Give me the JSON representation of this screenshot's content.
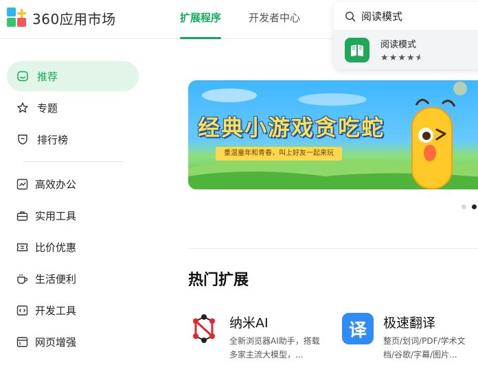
{
  "header": {
    "logo_text": "360应用市场",
    "tabs": [
      {
        "label": "扩展程序",
        "active": true
      },
      {
        "label": "开发者中心",
        "active": false
      }
    ]
  },
  "search": {
    "value": "阅读模式",
    "suggestion": {
      "name": "阅读模式",
      "rating": 4.5,
      "icon": "book-icon"
    }
  },
  "sidebar": {
    "items": [
      {
        "label": "推荐",
        "icon": "home-icon",
        "active": true
      },
      {
        "label": "专题",
        "icon": "star-icon"
      },
      {
        "label": "排行榜",
        "icon": "shield-icon"
      }
    ],
    "categories": [
      {
        "label": "高效办公",
        "icon": "chart-icon"
      },
      {
        "label": "实用工具",
        "icon": "toolbox-icon"
      },
      {
        "label": "比价优惠",
        "icon": "coupon-icon"
      },
      {
        "label": "生活便利",
        "icon": "cup-icon"
      },
      {
        "label": "开发工具",
        "icon": "code-icon"
      },
      {
        "label": "网页增强",
        "icon": "browser-icon"
      }
    ]
  },
  "banner": {
    "title": "经典小游戏贪吃蛇",
    "subtitle": "重温童年和青春，叫上好友一起来玩",
    "slide_count": 2,
    "active_slide": 2
  },
  "section": {
    "title": "热门扩展"
  },
  "cards": [
    {
      "name": "纳米AI",
      "desc": "全新浏览器AI助手，搭载多家主流大模型，...",
      "icon": "nami-ai-icon"
    },
    {
      "name": "极速翻译",
      "desc": "整页/划词/PDF/学术文档/谷歌/字幕/图片...",
      "icon": "translate-icon",
      "glyph": "译"
    }
  ],
  "colors": {
    "accent": "#13a95a",
    "active_bg": "#e1f5e8",
    "translate_blue": "#2f8cf5",
    "nami_red": "#e5252a"
  }
}
